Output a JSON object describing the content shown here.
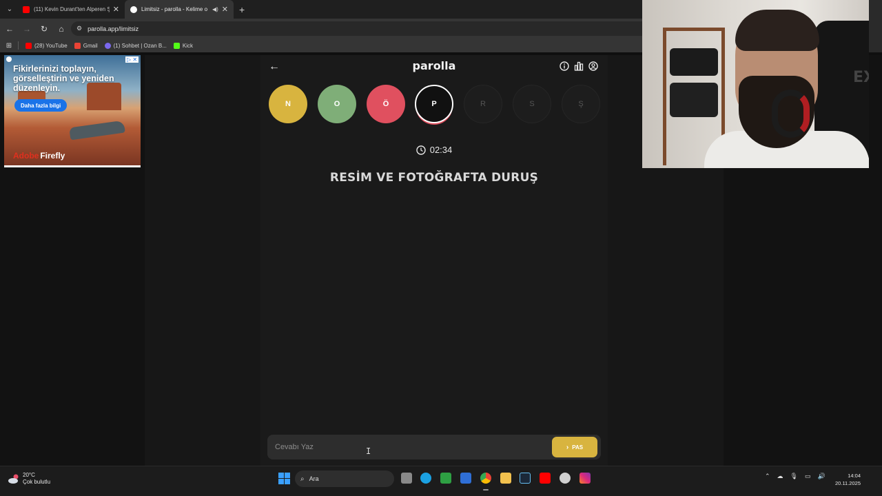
{
  "browser": {
    "tabs": [
      {
        "title": "(11) Kevin Durant'ten Alperen Ş",
        "active": false,
        "favicon_color": "#ff0000"
      },
      {
        "title": "Limitsiz - parolla - Kelime o",
        "active": true,
        "favicon_color": "#ffffff"
      }
    ],
    "url": "parolla.app/limitsiz",
    "bookmarks": [
      {
        "label": "(28) YouTube",
        "icon_color": "#ff0000"
      },
      {
        "label": "Gmail",
        "icon_color": "#ea4335"
      },
      {
        "label": "(1) Sohbet | Ozan B...",
        "icon_color": "#7b68ee"
      },
      {
        "label": "Kick",
        "icon_color": "#53fc18"
      }
    ]
  },
  "ad": {
    "headline": "Fikirlerinizi toplayın, görselleştirin ve yeniden düzenleyin.",
    "cta": "Daha fazla bilgi",
    "brand_prefix": "Adobe",
    "brand": "Firefly"
  },
  "app": {
    "logo": "parolla",
    "letters": [
      {
        "char": "N",
        "state": "correct"
      },
      {
        "char": "O",
        "state": "green"
      },
      {
        "char": "Ö",
        "state": "wrong"
      },
      {
        "char": "P",
        "state": "current"
      },
      {
        "char": "R",
        "state": "pending"
      },
      {
        "char": "S",
        "state": "pending"
      },
      {
        "char": "Ş",
        "state": "pending"
      }
    ],
    "timer": "02:34",
    "question": "RESİM VE FOTOĞRAFTA DURUŞ",
    "answer_placeholder": "Cevabı Yaz",
    "pass_label": "PAS",
    "colors": {
      "yellow": "#d8b43f",
      "green": "#7fae78",
      "red": "#e0505f"
    }
  },
  "taskbar": {
    "weather_temp": "20°C",
    "weather_desc": "Çok bulutlu",
    "search_label": "Ara",
    "time": "14:04",
    "date": "20.11.2025"
  }
}
